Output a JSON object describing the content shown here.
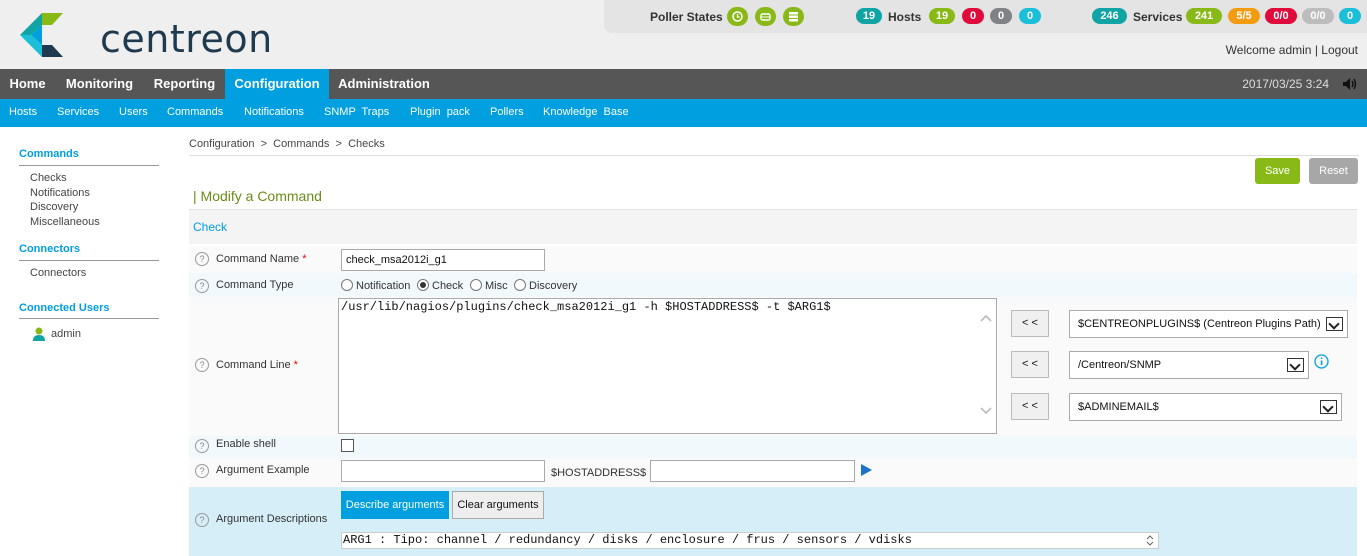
{
  "brand": {
    "name": "centreon",
    "colors": {
      "green": "#88b917",
      "teal": "#10a4a4",
      "blue": "#009fdf",
      "orange": "#f39c12",
      "red": "#e00b3d",
      "grey": "#818285",
      "cyan": "#1bc0d8"
    }
  },
  "topbar": {
    "poller_states_label": "Poller States",
    "poller_icons": [
      "clock-icon",
      "database-drive-icon",
      "stack-icon"
    ],
    "hosts": {
      "total": "19",
      "label": "Hosts",
      "up": "19",
      "down": "0",
      "unreachable": "0",
      "pending": "0"
    },
    "services": {
      "total": "246",
      "label": "Services",
      "ok": "241",
      "warning": "5/5",
      "critical": "0/0",
      "unknown": "0/0",
      "pending": "0"
    },
    "welcome": "Welcome admin",
    "separator": "|",
    "logout": "Logout"
  },
  "mainnav": {
    "items": [
      "Home",
      "Monitoring",
      "Reporting",
      "Configuration",
      "Administration"
    ],
    "active": "Configuration",
    "datetime": "2017/03/25 3:24"
  },
  "subnav": {
    "items": [
      "Hosts",
      "Services",
      "Users",
      "Commands",
      "Notifications",
      "SNMP  Traps",
      "Plugin  pack",
      "Pollers",
      "Knowledge  Base"
    ]
  },
  "sidebar": {
    "commands_header": "Commands",
    "commands_items": [
      "Checks",
      "Notifications",
      "Discovery",
      "Miscellaneous"
    ],
    "connectors_header": "Connectors",
    "connectors_items": [
      "Connectors"
    ],
    "connected_header": "Connected Users",
    "connected_users": [
      "admin"
    ]
  },
  "breadcrumb": {
    "items": [
      "Configuration",
      "Commands",
      "Checks"
    ],
    "separator": ">"
  },
  "actions": {
    "save": "Save",
    "reset": "Reset"
  },
  "form": {
    "title": "| Modify a Command",
    "section": "Check",
    "command_name": {
      "label": "Command Name",
      "required": "*",
      "value": "check_msa2012i_g1"
    },
    "command_type": {
      "label": "Command Type",
      "options": [
        "Notification",
        "Check",
        "Misc",
        "Discovery"
      ],
      "selected": "Check"
    },
    "command_line": {
      "label": "Command Line",
      "required": "*",
      "value": "/usr/lib/nagios/plugins/check_msa2012i_g1 -h $HOSTADDRESS$ -t $ARG1$",
      "insert_label": "< <",
      "macros": [
        "$CENTREONPLUGINS$ (Centreon Plugins Path)",
        "/Centreon/SNMP",
        "$ADMINEMAIL$"
      ]
    },
    "enable_shell": {
      "label": "Enable shell",
      "checked": false
    },
    "argument_example": {
      "label": "Argument Example",
      "value": "",
      "macro_label": "$HOSTADDRESS$",
      "macro_value": ""
    },
    "argument_descriptions": {
      "label": "Argument Descriptions",
      "describe_button": "Describe arguments",
      "clear_button": "Clear arguments",
      "value": "ARG1 : Tipo: channel / redundancy / disks / enclosure / frus / sensors / vdisks"
    }
  }
}
